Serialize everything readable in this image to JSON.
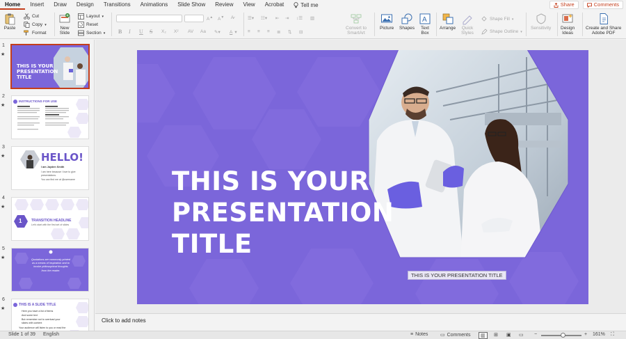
{
  "tabs": [
    "Home",
    "Insert",
    "Draw",
    "Design",
    "Transitions",
    "Animations",
    "Slide Show",
    "Review",
    "View",
    "Acrobat"
  ],
  "active_tab": "Home",
  "tell_me": "Tell me",
  "share_label": "Share",
  "comments_label": "Comments",
  "accent": "#c43e1c",
  "slide_bg": "#7b66da",
  "ribbon": {
    "paste": "Paste",
    "cut": "Cut",
    "copy": "Copy",
    "format": "Format",
    "new_slide_1": "New",
    "new_slide_2": "Slide",
    "layout": "Layout",
    "reset": "Reset",
    "section": "Section",
    "convert_1": "Convert to",
    "convert_2": "SmartArt",
    "picture": "Picture",
    "shapes": "Shapes",
    "textbox_1": "Text",
    "textbox_2": "Box",
    "arrange": "Arrange",
    "quick_1": "Quick",
    "quick_2": "Styles",
    "shape_fill": "Shape Fill",
    "shape_outline": "Shape Outline",
    "sensitivity": "Sensitivity",
    "design_1": "Design",
    "design_2": "Ideas",
    "create_1": "Create and Share",
    "create_2": "Adobe PDF",
    "bold": "B",
    "italic": "I",
    "underline": "U",
    "strike": "S"
  },
  "thumbnails": [
    {
      "num": "1",
      "title": "THIS IS YOUR PRESENTATION TITLE"
    },
    {
      "num": "2",
      "title": "INSTRUCTIONS FOR USE"
    },
    {
      "num": "3",
      "title": "HELLO!",
      "line1": "I am Jayden Smith",
      "line2": "I am here because I love to give presentations.",
      "line3": "You can find me at @username"
    },
    {
      "num": "4",
      "title": "TRANSITION HEADLINE",
      "sub": "Let's start with the first set of slides",
      "badge": "1"
    },
    {
      "num": "5",
      "quote": "Quotations are commonly printed as a means of inspiration and to invoke philosophical thoughts from the reader."
    },
    {
      "num": "6",
      "title": "THIS IS A SLIDE TITLE",
      "b1": "Here you have a list of items",
      "b2": "And some text",
      "b3": "But remember not to overload your slides with content",
      "b4": "Your audience will listen to you or read the"
    }
  ],
  "slide": {
    "title": "THIS IS YOUR\nPRESENTATION\nTITLE",
    "subtitle": "THIS IS YOUR PRESENTATION TITLE"
  },
  "notes_placeholder": "Click to add notes",
  "status": {
    "slide_counter": "Slide 1 of 39",
    "language": "English",
    "notes": "Notes",
    "comments": "Comments",
    "zoom": "161%"
  }
}
